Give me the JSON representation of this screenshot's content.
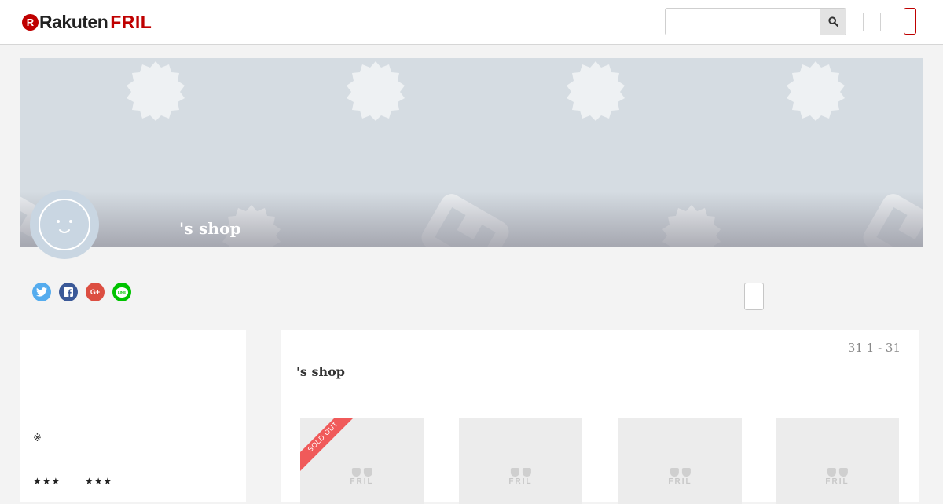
{
  "header": {
    "logo_rakuten": "Rakuten",
    "logo_fril": "FRIL",
    "logo_mark": "R",
    "search": {
      "placeholder": "",
      "value": ""
    },
    "icons": {
      "search": "search-icon"
    }
  },
  "banner": {
    "shop_name": "'s shop"
  },
  "social": {
    "twitter": "twitter-icon",
    "facebook": "facebook-icon",
    "google": "G+",
    "line": "LINE"
  },
  "side": {
    "note": "※",
    "stars_left": "★★★",
    "stars_right": "★★★"
  },
  "main": {
    "count": "31 1 - 31",
    "title": "'s shop",
    "items": [
      {
        "placeholder": "FRIL",
        "sold_out": "SOLD OUT"
      },
      {
        "placeholder": "FRIL"
      },
      {
        "placeholder": "FRIL"
      },
      {
        "placeholder": "FRIL"
      }
    ]
  },
  "colors": {
    "brand": "#bf0000",
    "twitter": "#55acee",
    "facebook": "#3b5998",
    "google": "#dc4e41",
    "line": "#00c300",
    "sold_out": "#f05a5a"
  }
}
